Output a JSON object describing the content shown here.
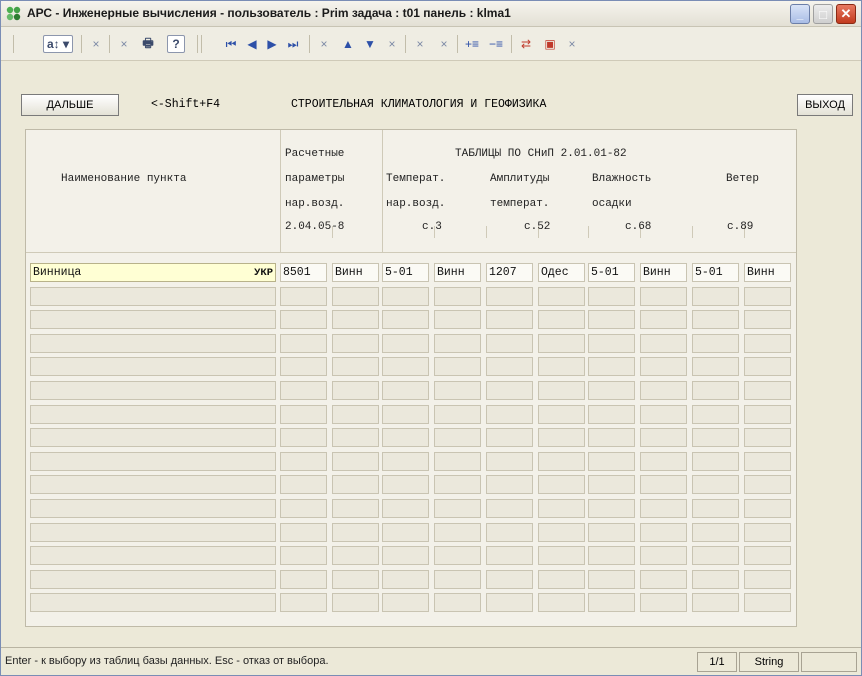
{
  "window": {
    "title": "АРС - Инженерные вычисления -  пользователь : Prim  задача : t01  панель : klma1",
    "min_glyph": "_",
    "max_glyph": "□",
    "close_glyph": "✕"
  },
  "toolbar": {
    "items": [
      {
        "name": "sort-dropdown-button",
        "glyph": "a↕ ▾"
      },
      {
        "name": "delete-icon-1",
        "glyph": "×"
      },
      {
        "name": "delete-icon-2",
        "glyph": "×"
      },
      {
        "name": "print-icon",
        "glyph": "🖶"
      },
      {
        "name": "help-button",
        "glyph": "?"
      },
      {
        "name": "first-record-icon",
        "glyph": "⏮"
      },
      {
        "name": "prev-record-icon",
        "glyph": "◀"
      },
      {
        "name": "next-record-icon",
        "glyph": "▶"
      },
      {
        "name": "last-record-icon",
        "glyph": "⏭"
      },
      {
        "name": "delete-icon-3",
        "glyph": "×"
      },
      {
        "name": "move-up-icon",
        "glyph": "▲"
      },
      {
        "name": "move-down-icon",
        "glyph": "▼"
      },
      {
        "name": "delete-icon-4",
        "glyph": "×"
      },
      {
        "name": "delete-icon-5",
        "glyph": "×"
      },
      {
        "name": "delete-icon-6",
        "glyph": "×"
      },
      {
        "name": "insert-row-icon",
        "glyph": "+≡"
      },
      {
        "name": "remove-row-icon",
        "glyph": "−≡"
      },
      {
        "name": "copy-values-icon",
        "glyph": "⇄"
      },
      {
        "name": "save-icon",
        "glyph": "▣"
      },
      {
        "name": "delete-icon-7",
        "glyph": "×"
      }
    ]
  },
  "panel": {
    "next_button": "ДАЛЬШЕ",
    "shift_hint": "<-Shift+F4",
    "heading": "СТРОИТЕЛЬНАЯ КЛИМАТОЛОГИЯ И ГЕОФИЗИКА",
    "exit_button": "ВЫХОД"
  },
  "table": {
    "header": {
      "name_col": "Наименование пункта",
      "calc_params": [
        "Расчетные",
        "параметры",
        "нар.возд.",
        "2.04.05-8"
      ],
      "group_title": "ТАБЛИЦЫ ПО СНиП 2.01.01-82",
      "temperature": [
        "Температ.",
        "нар.возд.",
        "с.3"
      ],
      "amplitude": [
        "Амплитуды",
        "температ.",
        "с.52"
      ],
      "humidity": [
        "Влажность",
        "осадки",
        "с.68"
      ],
      "wind": [
        "Ветер",
        "с.89"
      ]
    },
    "rows": [
      {
        "name": "Винница",
        "country": "УКР",
        "values": [
          "8501",
          "Винн",
          "5-01",
          "Винн",
          "1207",
          "Одес",
          "5-01",
          "Винн",
          "5-01",
          "Винн"
        ]
      }
    ],
    "empty_rows": 14
  },
  "statusbar": {
    "message": "Enter - к выбору из таблиц базы данных. Esc - отказ от выбора.",
    "page": "1/1",
    "type": "String",
    "extra": ""
  }
}
